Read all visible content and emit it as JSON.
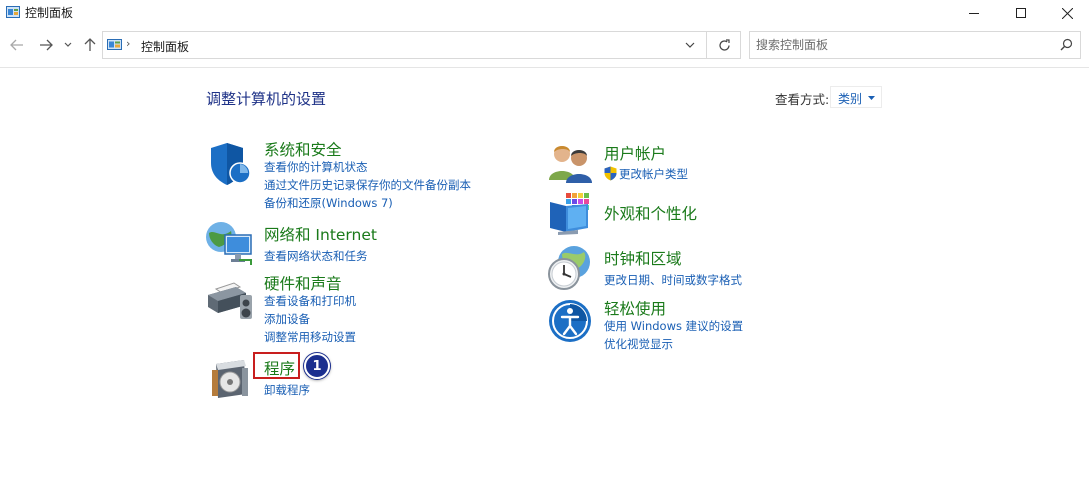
{
  "window": {
    "title": "控制面板"
  },
  "nav": {
    "address": "控制面板",
    "search_placeholder": "搜索控制面板"
  },
  "header": {
    "title": "调整计算机的设置",
    "view_by_label": "查看方式:",
    "view_by_value": "类别"
  },
  "categories_left": [
    {
      "title": "系统和安全",
      "icon": "shield-icon",
      "links": [
        "查看你的计算机状态",
        "通过文件历史记录保存你的文件备份副本",
        "备份和还原(Windows 7)"
      ]
    },
    {
      "title": "网络和 Internet",
      "icon": "network-icon",
      "links": [
        "查看网络状态和任务"
      ]
    },
    {
      "title": "硬件和声音",
      "icon": "printer-icon",
      "links": [
        "查看设备和打印机",
        "添加设备",
        "调整常用移动设置"
      ]
    },
    {
      "title": "程序",
      "icon": "programs-icon",
      "links": [
        "卸载程序"
      ]
    }
  ],
  "categories_right": [
    {
      "title": "用户帐户",
      "icon": "users-icon",
      "links": [
        "更改帐户类型"
      ]
    },
    {
      "title": "外观和个性化",
      "icon": "appearance-icon",
      "links": []
    },
    {
      "title": "时钟和区域",
      "icon": "clock-globe-icon",
      "links": [
        "更改日期、时间或数字格式"
      ]
    },
    {
      "title": "轻松使用",
      "icon": "ease-of-access-icon",
      "links": [
        "使用 Windows 建议的设置",
        "优化视觉显示"
      ]
    }
  ],
  "annotation": {
    "step_number": "1",
    "highlight_color": "#c81e1e",
    "badge_color": "#1b2f8f"
  }
}
